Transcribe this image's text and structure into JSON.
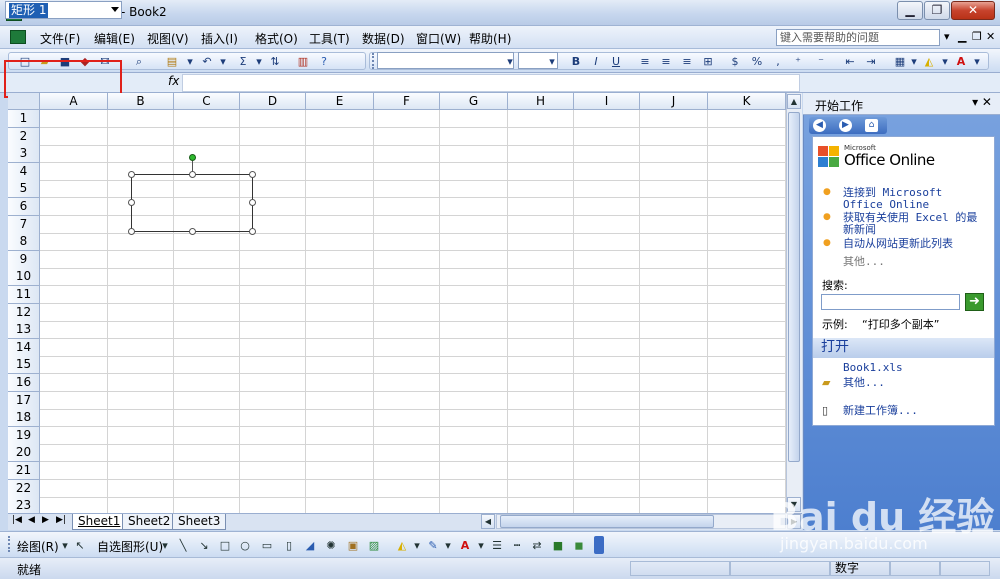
{
  "app": {
    "title": "Microsoft Excel - Book2",
    "icon": "excel-icon"
  },
  "window_controls": [
    "minimize",
    "restore",
    "close"
  ],
  "menus": [
    "文件(F)",
    "编辑(E)",
    "视图(V)",
    "插入(I)",
    "格式(O)",
    "工具(T)",
    "数据(D)",
    "窗口(W)",
    "帮助(H)"
  ],
  "help_box": {
    "placeholder": "键入需要帮助的问题"
  },
  "name_box": {
    "value": "矩形 1"
  },
  "formula": {
    "fx": "fx",
    "value": ""
  },
  "columns": [
    "A",
    "B",
    "C",
    "D",
    "E",
    "F",
    "G",
    "H",
    "I",
    "J",
    "K"
  ],
  "rows": [
    "1",
    "2",
    "3",
    "4",
    "5",
    "6",
    "7",
    "8",
    "9",
    "10",
    "11",
    "12",
    "13",
    "14",
    "15",
    "16",
    "17",
    "18",
    "19",
    "20",
    "21",
    "22",
    "23"
  ],
  "sheets": [
    "Sheet1",
    "Sheet2",
    "Sheet3"
  ],
  "active_sheet": "Sheet1",
  "draw_toolbar": {
    "draw": "绘图(R)",
    "autoshape": "自选图形(U)"
  },
  "status": {
    "left": "就绪",
    "right": "数字"
  },
  "task_pane": {
    "title": "开始工作",
    "logo_small": "Microsoft",
    "logo": "Office Online",
    "links": [
      "连接到 Microsoft Office Online",
      "获取有关使用 Excel 的最新新闻",
      "自动从网站更新此列表"
    ],
    "more": "其他...",
    "search_label": "搜索:",
    "example_label": "示例:",
    "example_value": "“打印多个副本”",
    "open_title": "打开",
    "recent_file": "Book1.xls",
    "open_more": "其他...",
    "new_workbook": "新建工作簿..."
  },
  "watermark": {
    "brand": "Bai du 经验",
    "url": "jingyan.baidu.com"
  },
  "colors": {
    "highlight_box": "#e0201a",
    "pane_blue": "#4d7fcf",
    "selection": "#1f5fb3"
  }
}
